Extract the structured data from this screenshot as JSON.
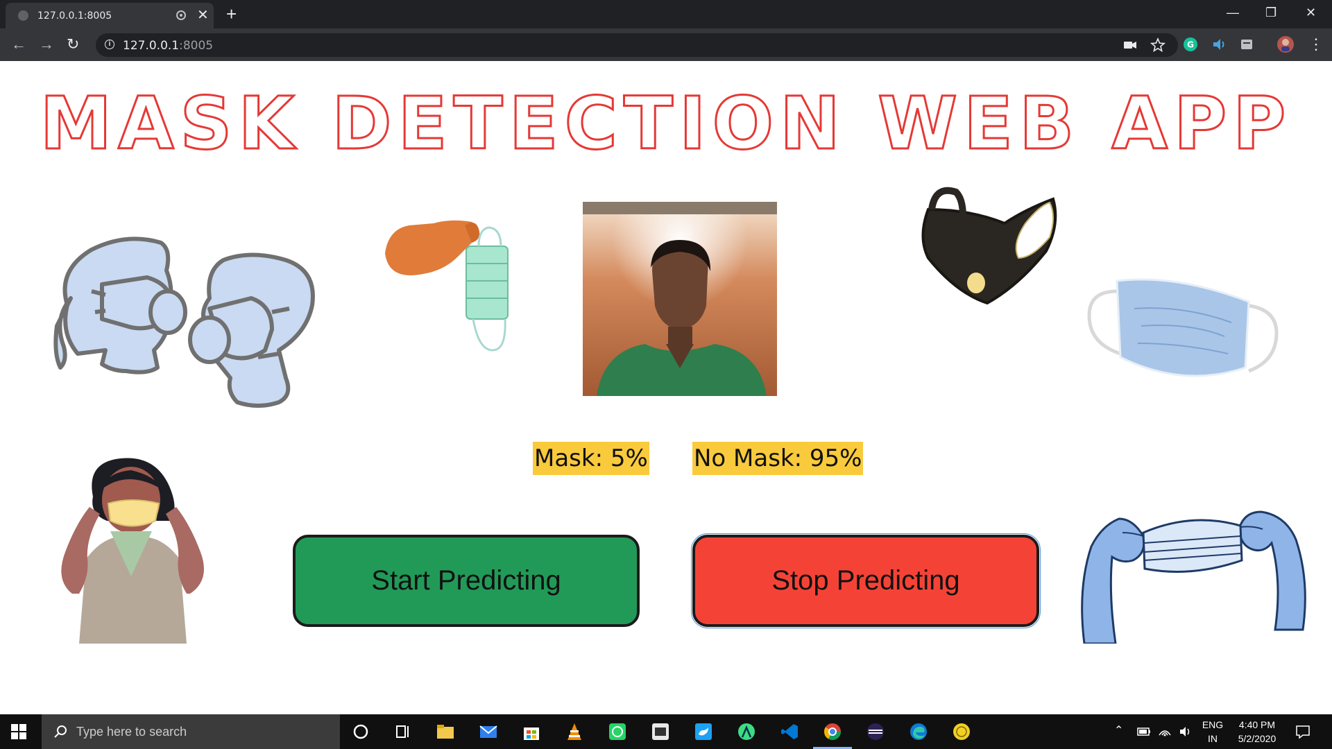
{
  "browser": {
    "tab_title": "127.0.0.1:8005",
    "url_host": "127.0.0.1",
    "url_port": ":8005",
    "close_glyph": "✕",
    "newtab_glyph": "+",
    "minimize_glyph": "—",
    "restore_glyph": "❐",
    "window_close_glyph": "✕",
    "back_glyph": "←",
    "forward_glyph": "→",
    "reload_glyph": "↻",
    "info_glyph": "i",
    "menu_glyph": "⋮"
  },
  "page": {
    "title": "MASK DETECTION WEB APP",
    "mask_label": "Mask: 5%",
    "no_mask_label": "No Mask: 95%",
    "mask_percent": 5,
    "no_mask_percent": 95,
    "start_button": "Start Predicting",
    "stop_button": "Stop Predicting"
  },
  "taskbar": {
    "search_placeholder": "Type here to search",
    "lang_1": "ENG",
    "lang_2": "IN",
    "time": "4:40 PM",
    "date": "5/2/2020"
  },
  "colors": {
    "title_outline": "#e53935",
    "start_button": "#219a57",
    "stop_button": "#f44336",
    "badge": "#f9ca3c"
  }
}
